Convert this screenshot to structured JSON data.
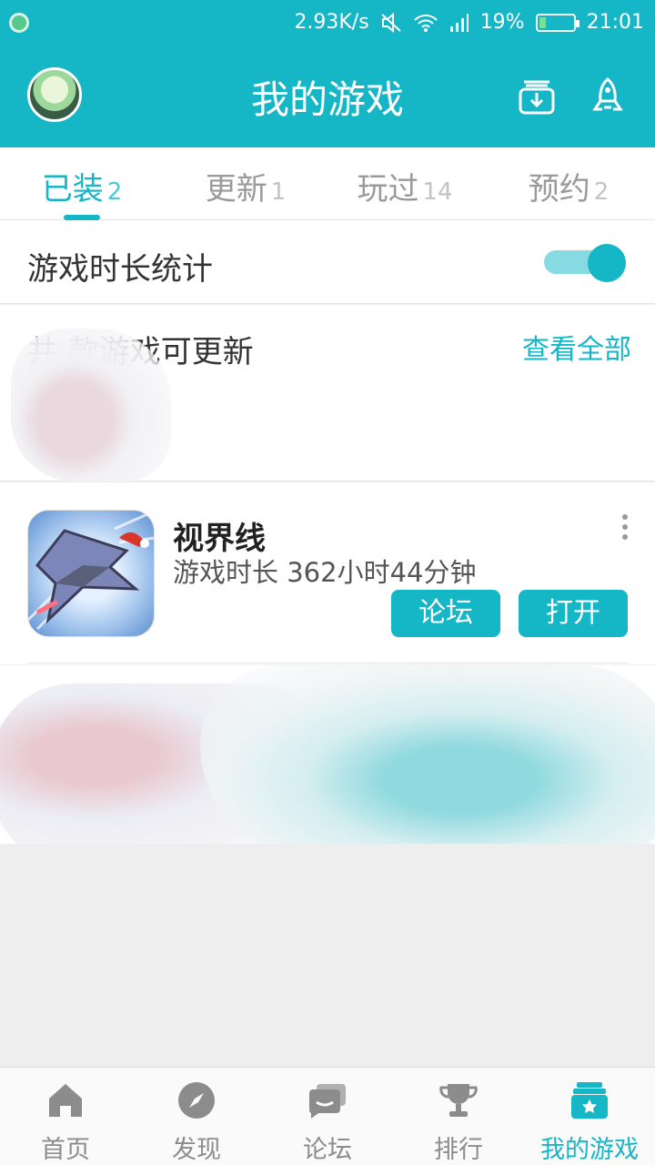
{
  "status_bar": {
    "speed": "2.93K/s",
    "battery": "19%",
    "battery_level": 0.19,
    "time": "21:01"
  },
  "header": {
    "title": "我的游戏"
  },
  "tabs": [
    {
      "label": "已装",
      "count": "2",
      "active": true
    },
    {
      "label": "更新",
      "count": "1",
      "active": false
    },
    {
      "label": "玩过",
      "count": "14",
      "active": false
    },
    {
      "label": "预约",
      "count": "2",
      "active": false
    }
  ],
  "stats": {
    "label": "游戏时长统计",
    "toggle_on": true
  },
  "updates": {
    "title": "共 款游戏可更新",
    "view_all": "查看全部"
  },
  "game": {
    "name": "视界线",
    "playtime": "游戏时长 362小时44分钟",
    "forum_button": "论坛",
    "open_button": "打开"
  },
  "bottom_nav": [
    {
      "label": "首页",
      "icon": "home-icon"
    },
    {
      "label": "发现",
      "icon": "compass-icon"
    },
    {
      "label": "论坛",
      "icon": "chat-icon"
    },
    {
      "label": "排行",
      "icon": "trophy-icon"
    },
    {
      "label": "我的游戏",
      "icon": "my-games-icon",
      "active": true
    }
  ],
  "colors": {
    "accent": "#15b6c6",
    "text": "#333333",
    "muted": "#8c8c8c"
  }
}
